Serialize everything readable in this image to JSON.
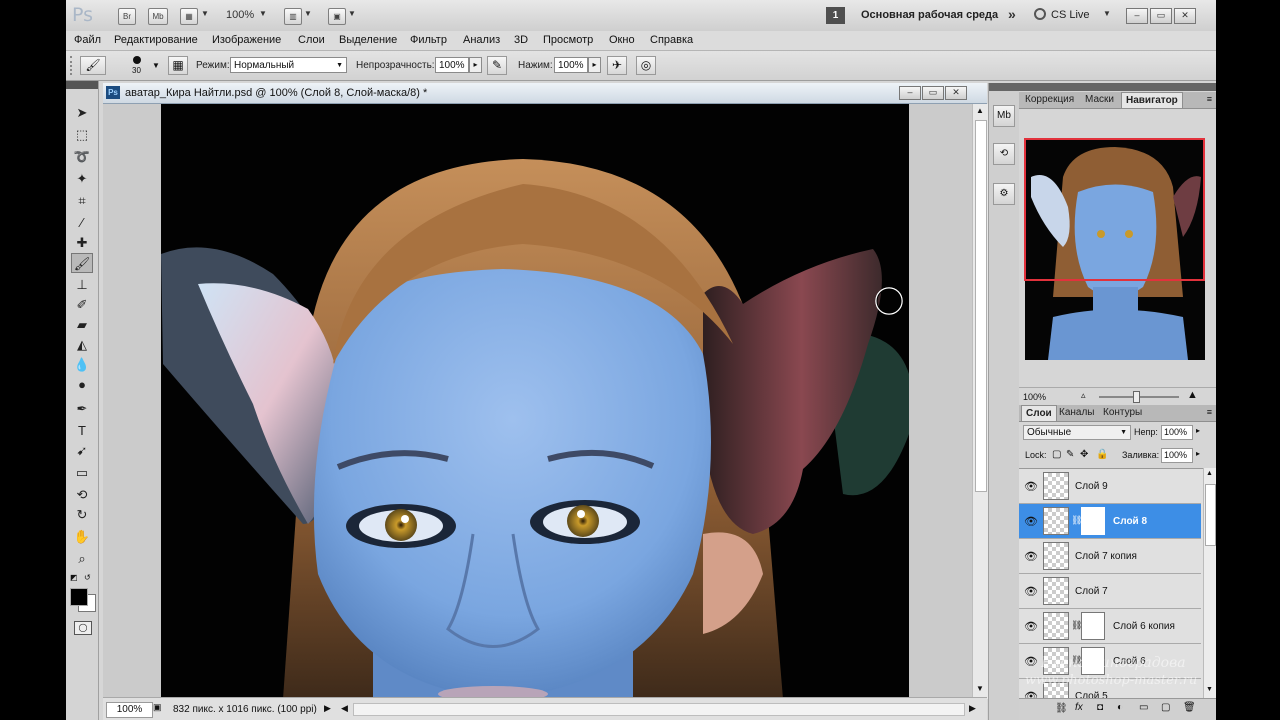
{
  "appbar": {
    "logo": "Ps",
    "bridge_label": "Br",
    "minibridge_label": "Mb",
    "zoom_value": "100%",
    "workspace_number": "1",
    "workspace_name": "Основная рабочая среда",
    "more_icon": "double-chevron-icon",
    "cslive_label": "CS Live"
  },
  "menu": [
    "Файл",
    "Редактирование",
    "Изображение",
    "Слои",
    "Выделение",
    "Фильтр",
    "Анализ",
    "3D",
    "Просмотр",
    "Окно",
    "Справка"
  ],
  "options": {
    "brush_size": "30",
    "mode_label": "Режим:",
    "mode_value": "Нормальный",
    "opacity_label": "Непрозрачность:",
    "opacity_value": "100%",
    "pressure_label": "Нажим:",
    "pressure_value": "100%"
  },
  "document": {
    "title": "аватар_Кира Найтли.psd @ 100% (Слой 8, Слой-маска/8) *",
    "zoom": "100%",
    "info": "832 пикс. x 1016 пикс. (100 ppi)"
  },
  "panels": {
    "top_tabs": [
      "Коррекция",
      "Маски",
      "Навигатор"
    ],
    "navigator_zoom": "100%",
    "layers_tabs": [
      "Слои",
      "Каналы",
      "Контуры"
    ],
    "blend_mode": "Обычные",
    "opacity_label": "Непр:",
    "opacity_value": "100%",
    "lock_label": "Lock:",
    "fill_label": "Заливка:",
    "fill_value": "100%",
    "layers": [
      {
        "name": "Слой 9",
        "mask": false,
        "selected": false
      },
      {
        "name": "Слой 8",
        "mask": true,
        "selected": true
      },
      {
        "name": "Слой 7 копия",
        "mask": false,
        "selected": false
      },
      {
        "name": "Слой 7",
        "mask": false,
        "selected": false
      },
      {
        "name": "Слой 6 копия",
        "mask": true,
        "selected": false
      },
      {
        "name": "Слой 6",
        "mask": true,
        "selected": false
      },
      {
        "name": "Слой 5",
        "mask": false,
        "selected": false
      }
    ]
  },
  "watermark": {
    "line1": "Елена Виноградова",
    "line2": "www.photoshop-master.ru"
  },
  "colors": {
    "selection": "#3d8ee6",
    "skin": "#7aa6e0",
    "hair": "#9b6a3a"
  }
}
